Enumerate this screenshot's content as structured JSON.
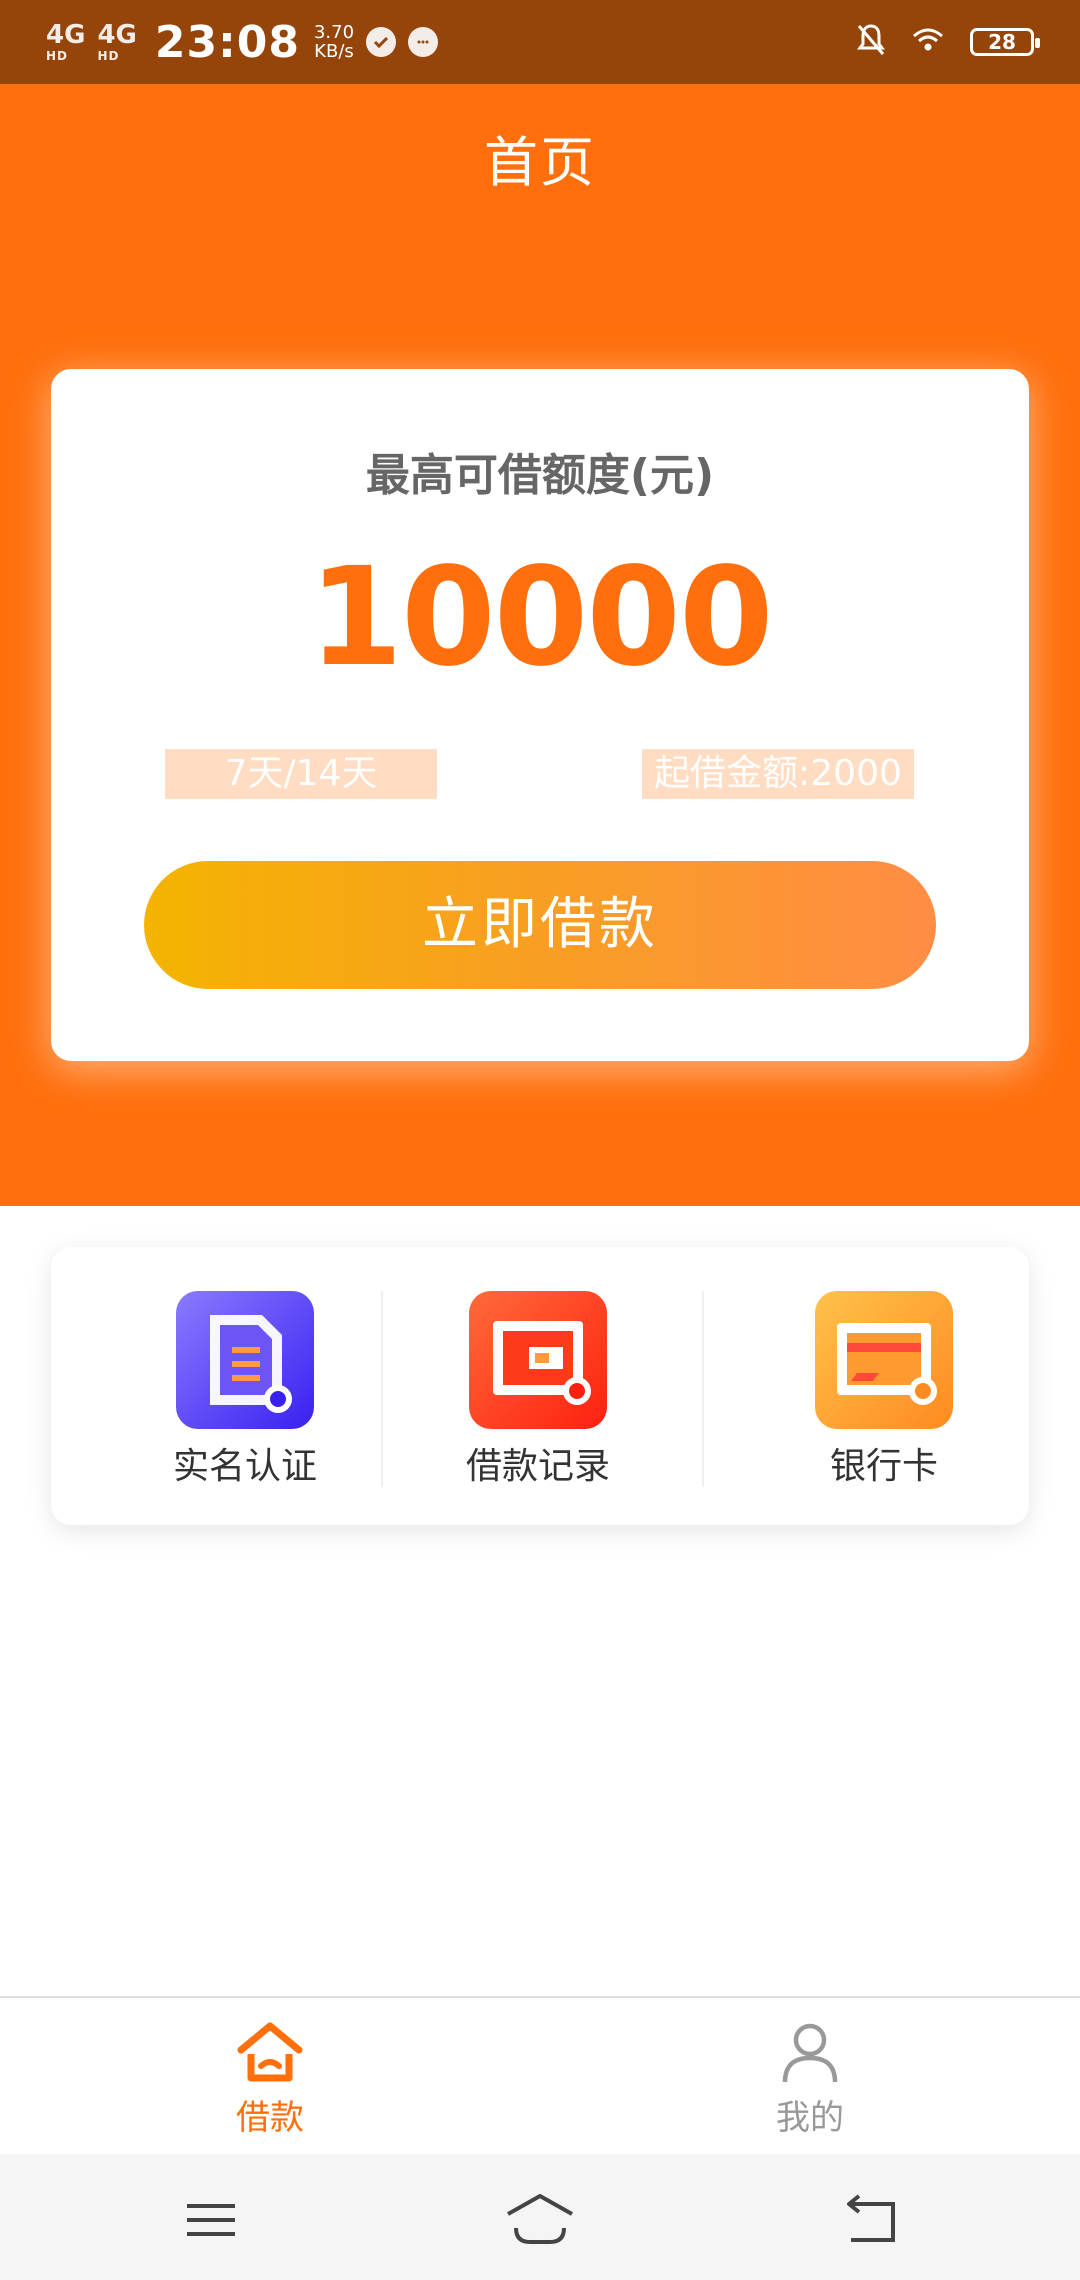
{
  "status_bar": {
    "network_1": "4G",
    "network_1_sub": "HD",
    "network_2": "4G",
    "network_2_sub": "HD",
    "time": "23:08",
    "speed_value": "3.70",
    "speed_unit": "KB/s",
    "battery": "28"
  },
  "header": {
    "title": "首页",
    "bg_color": "#ff6f0d"
  },
  "card": {
    "label": "最高可借额度(元)",
    "amount": "10000",
    "tag_term": "7天/14天",
    "tag_min": "起借金额:2000",
    "button_label": "立即借款"
  },
  "actions": [
    {
      "label": "实名认证",
      "icon": "id-document-icon"
    },
    {
      "label": "借款记录",
      "icon": "wallet-icon"
    },
    {
      "label": "银行卡",
      "icon": "bank-card-icon"
    }
  ],
  "tabbar": {
    "tabs": [
      {
        "label": "借款",
        "icon": "home-icon",
        "active": true
      },
      {
        "label": "我的",
        "icon": "user-icon",
        "active": false
      }
    ],
    "active_color": "#ff6f0d"
  },
  "system_nav": {
    "buttons": [
      "menu-icon",
      "home-nav-icon",
      "back-icon"
    ]
  }
}
